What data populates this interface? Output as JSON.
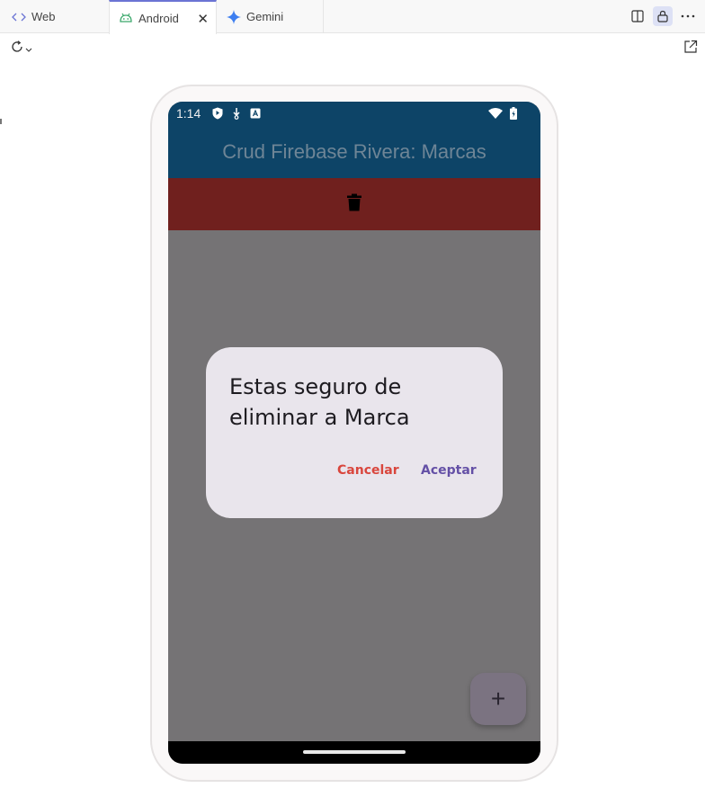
{
  "tabs": [
    {
      "label": "Web",
      "icon": "code-icon"
    },
    {
      "label": "Android",
      "icon": "android-icon",
      "active": true
    },
    {
      "label": "Gemini",
      "icon": "gemini-sparkle-icon"
    }
  ],
  "toolbar": {
    "right_icons": [
      "split-view-icon",
      "lock-icon",
      "more-icon"
    ],
    "reload_icon": "reload-icon",
    "popout_icon": "open-external-icon"
  },
  "status_bar": {
    "time": "1:14",
    "icons": [
      "shield-icon",
      "download-icon",
      "keyboard-a-icon",
      "wifi-icon",
      "battery-charging-icon"
    ]
  },
  "app": {
    "title": "Crud Firebase Rivera: Marcas",
    "delete_icon": "trash-icon",
    "fab_label": "+"
  },
  "dialog": {
    "message": "Estas seguro de eliminar a Marca",
    "cancel_label": "Cancelar",
    "accept_label": "Aceptar"
  },
  "colors": {
    "appbar": "#0d4467",
    "delete_bar": "#70201e",
    "cancel": "#d9463d",
    "accept": "#6450a6",
    "dialog_bg": "#e9e5ec"
  }
}
